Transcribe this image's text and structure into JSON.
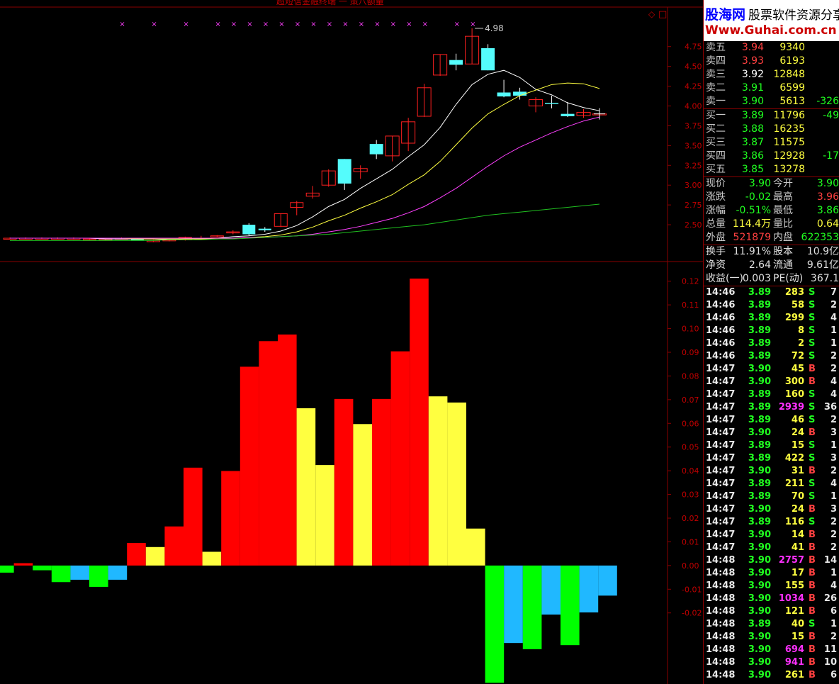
{
  "header_text": "超短信金融终端 一 策八额量",
  "price_axis": [
    "4.75",
    "4.50",
    "4.25",
    "4.00",
    "3.75",
    "3.50",
    "3.25",
    "3.00",
    "2.75",
    "2.50"
  ],
  "osc_axis": [
    "0.12",
    "0.11",
    "0.10",
    "0.09",
    "0.08",
    "0.07",
    "0.06",
    "0.05",
    "0.04",
    "0.03",
    "0.02",
    "0.01",
    "0.00",
    "-0.01",
    "-0.02"
  ],
  "peak_label": "4.98",
  "colors": {
    "up": "#ff2020",
    "down": "#54fcfc",
    "ma5": "#ffffff",
    "ma10": "#ffff40",
    "ma20": "#ff40ff",
    "ma60": "#20c020",
    "bar_red": "#ff0000",
    "bar_yellow": "#ffff40",
    "bar_green": "#00ff00",
    "bar_blue": "#20b8ff",
    "sell": "#ff4040",
    "buy": "#20ff20",
    "white": "#ffffff",
    "yellow": "#ffff40",
    "magenta": "#ff30ff"
  },
  "logo": {
    "name": "股海网",
    "slogan": "股票软件资源分享",
    "url": "Www.Guhai.com.cn"
  },
  "sell": [
    {
      "label": "卖五",
      "price": "3.94",
      "vol": "9340",
      "diff": ""
    },
    {
      "label": "卖四",
      "price": "3.93",
      "vol": "6193",
      "diff": ""
    },
    {
      "label": "卖三",
      "price": "3.92",
      "vol": "12848",
      "diff": ""
    },
    {
      "label": "卖二",
      "price": "3.91",
      "vol": "6599",
      "diff": ""
    },
    {
      "label": "卖一",
      "price": "3.90",
      "vol": "5613",
      "diff": "-326"
    }
  ],
  "buy": [
    {
      "label": "买一",
      "price": "3.89",
      "vol": "11796",
      "diff": "-49"
    },
    {
      "label": "买二",
      "price": "3.88",
      "vol": "16235",
      "diff": ""
    },
    {
      "label": "买三",
      "price": "3.87",
      "vol": "11575",
      "diff": ""
    },
    {
      "label": "买四",
      "price": "3.86",
      "vol": "12928",
      "diff": "-17"
    },
    {
      "label": "买五",
      "price": "3.85",
      "vol": "13278",
      "diff": ""
    }
  ],
  "stats": [
    {
      "l1": "现价",
      "v1": "3.90",
      "l2": "今开",
      "v2": "3.90"
    },
    {
      "l1": "涨跌",
      "v1": "-0.02",
      "l2": "最高",
      "v2": "3.96"
    },
    {
      "l1": "涨幅",
      "v1": "-0.51%",
      "l2": "最低",
      "v2": "3.86"
    },
    {
      "l1": "总量",
      "v1": "114.4万",
      "l2": "量比",
      "v2": "0.64"
    },
    {
      "l1": "外盘",
      "v1": "521879",
      "l2": "内盘",
      "v2": "622353"
    }
  ],
  "stats2": [
    {
      "l1": "换手",
      "v1": "11.91%",
      "l2": "股本",
      "v2": "10.9亿"
    },
    {
      "l1": "净资",
      "v1": "2.64",
      "l2": "流通",
      "v2": "9.61亿"
    },
    {
      "l1": "收益(一)",
      "v1": "0.003",
      "l2": "PE(动)",
      "v2": "367.1"
    }
  ],
  "ticks": [
    {
      "t": "14:46",
      "p": "3.89",
      "v": "283",
      "s": "S",
      "n": "7"
    },
    {
      "t": "14:46",
      "p": "3.89",
      "v": "58",
      "s": "S",
      "n": "2"
    },
    {
      "t": "14:46",
      "p": "3.89",
      "v": "299",
      "s": "S",
      "n": "4"
    },
    {
      "t": "14:46",
      "p": "3.89",
      "v": "8",
      "s": "S",
      "n": "1"
    },
    {
      "t": "14:46",
      "p": "3.89",
      "v": "2",
      "s": "S",
      "n": "1"
    },
    {
      "t": "14:46",
      "p": "3.89",
      "v": "72",
      "s": "S",
      "n": "2"
    },
    {
      "t": "14:47",
      "p": "3.90",
      "v": "45",
      "s": "B",
      "n": "2"
    },
    {
      "t": "14:47",
      "p": "3.90",
      "v": "300",
      "s": "B",
      "n": "4"
    },
    {
      "t": "14:47",
      "p": "3.89",
      "v": "160",
      "s": "S",
      "n": "4"
    },
    {
      "t": "14:47",
      "p": "3.89",
      "v": "2939",
      "s": "S",
      "n": "36"
    },
    {
      "t": "14:47",
      "p": "3.89",
      "v": "46",
      "s": "S",
      "n": "2"
    },
    {
      "t": "14:47",
      "p": "3.90",
      "v": "24",
      "s": "B",
      "n": "3"
    },
    {
      "t": "14:47",
      "p": "3.89",
      "v": "15",
      "s": "S",
      "n": "1"
    },
    {
      "t": "14:47",
      "p": "3.89",
      "v": "422",
      "s": "S",
      "n": "3"
    },
    {
      "t": "14:47",
      "p": "3.90",
      "v": "31",
      "s": "B",
      "n": "2"
    },
    {
      "t": "14:47",
      "p": "3.89",
      "v": "211",
      "s": "S",
      "n": "4"
    },
    {
      "t": "14:47",
      "p": "3.89",
      "v": "70",
      "s": "S",
      "n": "1"
    },
    {
      "t": "14:47",
      "p": "3.90",
      "v": "24",
      "s": "B",
      "n": "3"
    },
    {
      "t": "14:47",
      "p": "3.89",
      "v": "116",
      "s": "S",
      "n": "2"
    },
    {
      "t": "14:47",
      "p": "3.90",
      "v": "14",
      "s": "B",
      "n": "2"
    },
    {
      "t": "14:47",
      "p": "3.90",
      "v": "41",
      "s": "B",
      "n": "2"
    },
    {
      "t": "14:48",
      "p": "3.90",
      "v": "2757",
      "s": "B",
      "n": "14"
    },
    {
      "t": "14:48",
      "p": "3.90",
      "v": "17",
      "s": "B",
      "n": "1"
    },
    {
      "t": "14:48",
      "p": "3.90",
      "v": "155",
      "s": "B",
      "n": "4"
    },
    {
      "t": "14:48",
      "p": "3.90",
      "v": "1034",
      "s": "B",
      "n": "26"
    },
    {
      "t": "14:48",
      "p": "3.90",
      "v": "121",
      "s": "B",
      "n": "6"
    },
    {
      "t": "14:48",
      "p": "3.89",
      "v": "40",
      "s": "S",
      "n": "1"
    },
    {
      "t": "14:48",
      "p": "3.90",
      "v": "15",
      "s": "B",
      "n": "2"
    },
    {
      "t": "14:48",
      "p": "3.90",
      "v": "694",
      "s": "B",
      "n": "11"
    },
    {
      "t": "14:48",
      "p": "3.90",
      "v": "941",
      "s": "B",
      "n": "10"
    },
    {
      "t": "14:48",
      "p": "3.90",
      "v": "261",
      "s": "B",
      "n": "6"
    }
  ],
  "chart_data": [
    {
      "type": "candlestick",
      "candles": [
        {
          "o": 2.33,
          "h": 2.34,
          "l": 2.32,
          "c": 2.33
        },
        {
          "o": 2.33,
          "h": 2.34,
          "l": 2.32,
          "c": 2.33
        },
        {
          "o": 2.33,
          "h": 2.34,
          "l": 2.32,
          "c": 2.33
        },
        {
          "o": 2.33,
          "h": 2.34,
          "l": 2.32,
          "c": 2.33
        },
        {
          "o": 2.33,
          "h": 2.34,
          "l": 2.31,
          "c": 2.33
        },
        {
          "o": 2.32,
          "h": 2.33,
          "l": 2.31,
          "c": 2.32
        },
        {
          "o": 2.32,
          "h": 2.33,
          "l": 2.3,
          "c": 2.32
        },
        {
          "o": 2.33,
          "h": 2.34,
          "l": 2.32,
          "c": 2.33
        },
        {
          "o": 2.32,
          "h": 2.33,
          "l": 2.31,
          "c": 2.31
        },
        {
          "o": 2.29,
          "h": 2.31,
          "l": 2.28,
          "c": 2.3
        },
        {
          "o": 2.3,
          "h": 2.32,
          "l": 2.29,
          "c": 2.31
        },
        {
          "o": 2.31,
          "h": 2.35,
          "l": 2.3,
          "c": 2.34
        },
        {
          "o": 2.33,
          "h": 2.36,
          "l": 2.32,
          "c": 2.33
        },
        {
          "o": 2.35,
          "h": 2.37,
          "l": 2.34,
          "c": 2.36
        },
        {
          "o": 2.4,
          "h": 2.43,
          "l": 2.38,
          "c": 2.41
        },
        {
          "o": 2.5,
          "h": 2.52,
          "l": 2.36,
          "c": 2.38
        },
        {
          "o": 2.45,
          "h": 2.47,
          "l": 2.41,
          "c": 2.43
        },
        {
          "o": 2.48,
          "h": 2.64,
          "l": 2.47,
          "c": 2.64
        },
        {
          "o": 2.72,
          "h": 2.8,
          "l": 2.62,
          "c": 2.78
        },
        {
          "o": 2.86,
          "h": 2.99,
          "l": 2.83,
          "c": 2.9
        },
        {
          "o": 3.0,
          "h": 3.2,
          "l": 2.98,
          "c": 3.18
        },
        {
          "o": 3.33,
          "h": 3.33,
          "l": 2.94,
          "c": 3.02
        },
        {
          "o": 3.17,
          "h": 3.25,
          "l": 3.08,
          "c": 3.21
        },
        {
          "o": 3.52,
          "h": 3.57,
          "l": 3.33,
          "c": 3.39
        },
        {
          "o": 3.37,
          "h": 3.62,
          "l": 3.3,
          "c": 3.62
        },
        {
          "o": 3.53,
          "h": 3.85,
          "l": 3.43,
          "c": 3.8
        },
        {
          "o": 3.87,
          "h": 4.28,
          "l": 3.86,
          "c": 4.23
        },
        {
          "o": 4.39,
          "h": 4.65,
          "l": 4.38,
          "c": 4.65
        },
        {
          "o": 4.58,
          "h": 4.66,
          "l": 4.45,
          "c": 4.52
        },
        {
          "o": 4.53,
          "h": 4.98,
          "l": 4.53,
          "c": 4.88
        },
        {
          "o": 4.73,
          "h": 4.78,
          "l": 4.45,
          "c": 4.45
        },
        {
          "o": 4.17,
          "h": 4.33,
          "l": 4.11,
          "c": 4.12
        },
        {
          "o": 4.18,
          "h": 4.23,
          "l": 4.08,
          "c": 4.13
        },
        {
          "o": 4.0,
          "h": 4.11,
          "l": 3.92,
          "c": 4.08
        },
        {
          "o": 4.04,
          "h": 4.13,
          "l": 3.97,
          "c": 4.03
        },
        {
          "o": 3.9,
          "h": 4.05,
          "l": 3.86,
          "c": 3.87
        },
        {
          "o": 3.88,
          "h": 3.96,
          "l": 3.85,
          "c": 3.92
        },
        {
          "o": 3.9,
          "h": 3.96,
          "l": 3.86,
          "c": 3.9
        }
      ],
      "ma_lines": [
        {
          "name": "MA5",
          "values": [
            2.33,
            2.33,
            2.33,
            2.33,
            2.33,
            2.33,
            2.32,
            2.32,
            2.32,
            2.32,
            2.31,
            2.32,
            2.32,
            2.33,
            2.35,
            2.36,
            2.38,
            2.42,
            2.49,
            2.6,
            2.73,
            2.82,
            2.96,
            3.08,
            3.2,
            3.36,
            3.51,
            3.73,
            4.02,
            4.27,
            4.4,
            4.45,
            4.36,
            4.21,
            4.14,
            4.04,
            3.98,
            3.94
          ]
        },
        {
          "name": "MA10",
          "values": [
            2.33,
            2.33,
            2.33,
            2.33,
            2.33,
            2.33,
            2.33,
            2.33,
            2.32,
            2.32,
            2.32,
            2.32,
            2.32,
            2.32,
            2.33,
            2.34,
            2.35,
            2.37,
            2.41,
            2.47,
            2.55,
            2.62,
            2.71,
            2.79,
            2.88,
            3.01,
            3.13,
            3.3,
            3.51,
            3.72,
            3.9,
            4.02,
            4.13,
            4.2,
            4.27,
            4.29,
            4.28,
            4.22
          ]
        },
        {
          "name": "MA20",
          "values": [
            2.33,
            2.33,
            2.33,
            2.33,
            2.33,
            2.33,
            2.33,
            2.33,
            2.33,
            2.33,
            2.33,
            2.33,
            2.33,
            2.33,
            2.33,
            2.34,
            2.34,
            2.35,
            2.36,
            2.38,
            2.41,
            2.44,
            2.48,
            2.53,
            2.58,
            2.65,
            2.73,
            2.84,
            2.96,
            3.1,
            3.24,
            3.37,
            3.48,
            3.57,
            3.66,
            3.74,
            3.81,
            3.86
          ]
        },
        {
          "name": "MA60",
          "values": [
            2.3,
            2.3,
            2.3,
            2.3,
            2.3,
            2.3,
            2.3,
            2.3,
            2.3,
            2.3,
            2.31,
            2.31,
            2.31,
            2.32,
            2.32,
            2.33,
            2.34,
            2.35,
            2.36,
            2.37,
            2.38,
            2.4,
            2.42,
            2.44,
            2.46,
            2.48,
            2.5,
            2.53,
            2.56,
            2.59,
            2.62,
            2.64,
            2.66,
            2.68,
            2.7,
            2.72,
            2.74,
            2.76
          ]
        }
      ],
      "ylim": [
        2.25,
        4.98
      ],
      "markers_x": [
        7,
        9,
        11,
        13,
        14,
        15,
        16,
        17,
        18,
        19,
        20,
        21,
        22,
        23,
        24,
        25,
        26,
        28,
        29
      ]
    },
    {
      "type": "bar",
      "values": [
        -0.003,
        0.001,
        -0.002,
        -0.007,
        -0.006,
        -0.009,
        -0.006,
        0.0095,
        0.0078,
        0.0165,
        0.0413,
        0.0058,
        0.0399,
        0.0839,
        0.0947,
        0.0975,
        0.0664,
        0.0424,
        0.0703,
        0.0597,
        0.0703,
        0.0904,
        0.1211,
        0.0714,
        0.0688,
        0.0156,
        -0.0495,
        -0.0327,
        -0.0353,
        -0.0207,
        -0.0336,
        -0.0198,
        -0.0127
      ],
      "colors": [
        "green",
        "red",
        "green",
        "green",
        "blue",
        "green",
        "blue",
        "red",
        "yellow",
        "red",
        "red",
        "yellow",
        "red",
        "red",
        "red",
        "red",
        "yellow",
        "yellow",
        "red",
        "yellow",
        "red",
        "red",
        "red",
        "yellow",
        "yellow",
        "yellow",
        "green",
        "blue",
        "green",
        "blue",
        "green",
        "blue",
        "blue"
      ],
      "ylim": [
        -0.05,
        0.125
      ]
    }
  ]
}
